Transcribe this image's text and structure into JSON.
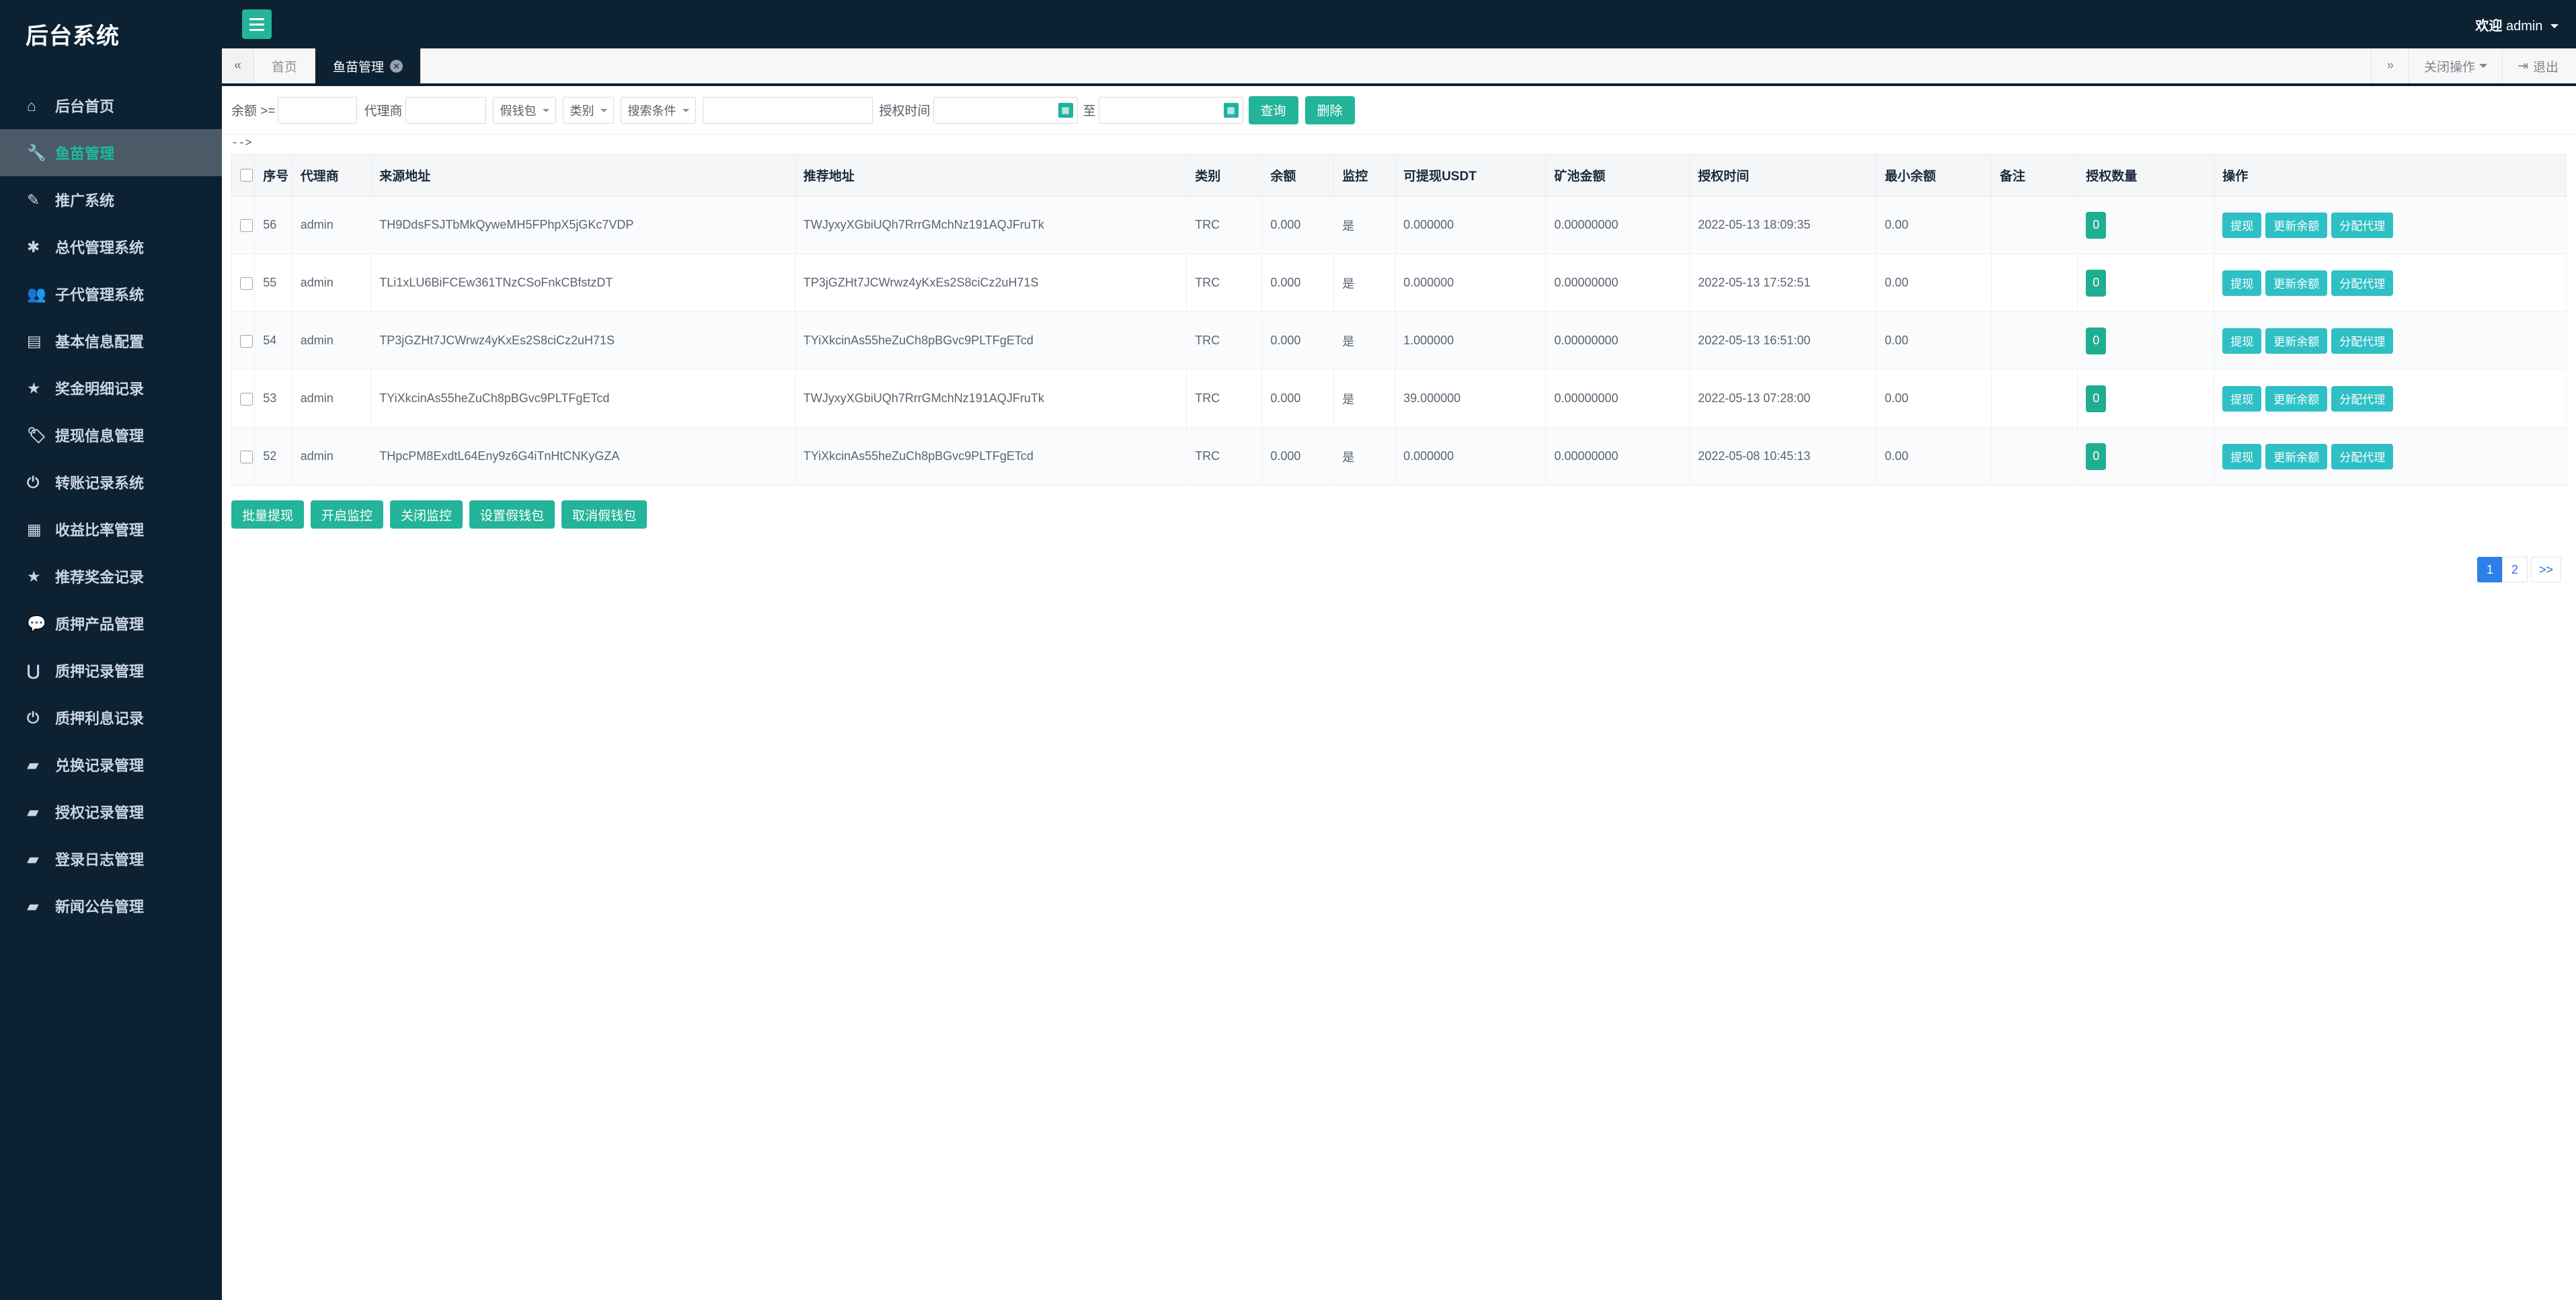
{
  "sidebar": {
    "brand": "后台系统",
    "items": [
      {
        "label": "后台首页",
        "icon": "home-icon",
        "glyph": "⌂",
        "active": false
      },
      {
        "label": "鱼苗管理",
        "icon": "wrench-icon",
        "glyph": "🔧",
        "active": true
      },
      {
        "label": "推广系统",
        "icon": "edit-square-icon",
        "glyph": "✎",
        "active": false
      },
      {
        "label": "总代管理系统",
        "icon": "asterisk-icon",
        "glyph": "✱",
        "active": false
      },
      {
        "label": "子代管理系统",
        "icon": "users-icon",
        "glyph": "👥",
        "active": false
      },
      {
        "label": "基本信息配置",
        "icon": "document-icon",
        "glyph": "▤",
        "active": false
      },
      {
        "label": "奖金明细记录",
        "icon": "star-icon",
        "glyph": "★",
        "active": false
      },
      {
        "label": "提现信息管理",
        "icon": "tag-icon",
        "glyph": "🏷",
        "active": false
      },
      {
        "label": "转账记录系统",
        "icon": "power-icon",
        "glyph": "⏻",
        "active": false
      },
      {
        "label": "收益比率管理",
        "icon": "calendar-icon",
        "glyph": "▦",
        "active": false
      },
      {
        "label": "推荐奖金记录",
        "icon": "star-icon",
        "glyph": "★",
        "active": false
      },
      {
        "label": "质押产品管理",
        "icon": "comment-icon",
        "glyph": "💬",
        "active": false
      },
      {
        "label": "质押记录管理",
        "icon": "magnet-icon",
        "glyph": "⋃",
        "active": false
      },
      {
        "label": "质押利息记录",
        "icon": "power-icon",
        "glyph": "⏻",
        "active": false
      },
      {
        "label": "兑换记录管理",
        "icon": "book-icon",
        "glyph": "▰",
        "active": false
      },
      {
        "label": "授权记录管理",
        "icon": "book-icon",
        "glyph": "▰",
        "active": false
      },
      {
        "label": "登录日志管理",
        "icon": "book-icon",
        "glyph": "▰",
        "active": false
      },
      {
        "label": "新闻公告管理",
        "icon": "book-icon",
        "glyph": "▰",
        "active": false
      }
    ]
  },
  "topbar": {
    "menu_toggle_icon": "hamburger-icon",
    "welcome_prefix": "欢迎",
    "username": "admin"
  },
  "tabstrip": {
    "prev_arrow": "«",
    "next_arrow": "»",
    "tabs": [
      {
        "label": "首页",
        "active": false,
        "closable": false
      },
      {
        "label": "鱼苗管理",
        "active": true,
        "closable": true
      }
    ],
    "close_ops_label": "关闭操作",
    "logout_label": "退出",
    "logout_icon": "logout-icon"
  },
  "toolbar": {
    "balance_label": "余额 >=",
    "balance_value": "",
    "balance_placeholder": "",
    "agent_label": "代理商",
    "agent_value": "",
    "fake_wallet_select": "假钱包",
    "category_select": "类别",
    "search_condition_select": "搜索条件",
    "keyword_value": "",
    "auth_time_label": "授权时间",
    "date_start": "",
    "date_end": "",
    "date_between_label": "至",
    "calendar_icon": "calendar-icon",
    "query_button": "查询",
    "delete_button": "删除"
  },
  "artifact_text": "-->",
  "table": {
    "select_all_icon": "checkbox-icon",
    "headers": [
      "",
      "序号",
      "代理商",
      "来源地址",
      "推荐地址",
      "类别",
      "余额",
      "监控",
      "可提现USDT",
      "矿池金额",
      "授权时间",
      "最小余额",
      "备注",
      "授权数量",
      "操作"
    ],
    "row_actions": [
      "提现",
      "更新余额",
      "分配代理"
    ],
    "rows": [
      {
        "id": "56",
        "agent": "admin",
        "source_address": "TH9DdsFSJTbMkQyweMH5FPhpX5jGKc7VDP",
        "referrer_address": "TWJyxyXGbiUQh7RrrGMchNz191AQJFruTk",
        "category": "TRC",
        "balance": "0.000",
        "monitor": "是",
        "withdrawable_usdt": "0.000000",
        "pool_amount": "0.00000000",
        "auth_time": "2022-05-13 18:09:35",
        "min_balance": "0.00",
        "remark": "",
        "auth_count": "0"
      },
      {
        "id": "55",
        "agent": "admin",
        "source_address": "TLi1xLU6BiFCEw361TNzCSoFnkCBfstzDT",
        "referrer_address": "TP3jGZHt7JCWrwz4yKxEs2S8ciCz2uH71S",
        "category": "TRC",
        "balance": "0.000",
        "monitor": "是",
        "withdrawable_usdt": "0.000000",
        "pool_amount": "0.00000000",
        "auth_time": "2022-05-13 17:52:51",
        "min_balance": "0.00",
        "remark": "",
        "auth_count": "0"
      },
      {
        "id": "54",
        "agent": "admin",
        "source_address": "TP3jGZHt7JCWrwz4yKxEs2S8ciCz2uH71S",
        "referrer_address": "TYiXkcinAs55heZuCh8pBGvc9PLTFgETcd",
        "category": "TRC",
        "balance": "0.000",
        "monitor": "是",
        "withdrawable_usdt": "1.000000",
        "pool_amount": "0.00000000",
        "auth_time": "2022-05-13 16:51:00",
        "min_balance": "0.00",
        "remark": "",
        "auth_count": "0"
      },
      {
        "id": "53",
        "agent": "admin",
        "source_address": "TYiXkcinAs55heZuCh8pBGvc9PLTFgETcd",
        "referrer_address": "TWJyxyXGbiUQh7RrrGMchNz191AQJFruTk",
        "category": "TRC",
        "balance": "0.000",
        "monitor": "是",
        "withdrawable_usdt": "39.000000",
        "pool_amount": "0.00000000",
        "auth_time": "2022-05-13 07:28:00",
        "min_balance": "0.00",
        "remark": "",
        "auth_count": "0"
      },
      {
        "id": "52",
        "agent": "admin",
        "source_address": "THpcPM8ExdtL64Eny9z6G4iTnHtCNKyGZA",
        "referrer_address": "TYiXkcinAs55heZuCh8pBGvc9PLTFgETcd",
        "category": "TRC",
        "balance": "0.000",
        "monitor": "是",
        "withdrawable_usdt": "0.000000",
        "pool_amount": "0.00000000",
        "auth_time": "2022-05-08 10:45:13",
        "min_balance": "0.00",
        "remark": "",
        "auth_count": "0"
      }
    ]
  },
  "bulk_actions": [
    "批量提现",
    "开启监控",
    "关闭监控",
    "设置假钱包",
    "取消假钱包"
  ],
  "pagination": {
    "pages": [
      "1",
      "2"
    ],
    "active_page": "1",
    "next_label": ">>"
  },
  "colors": {
    "sidebar_bg": "#0c2233",
    "accent_green": "#23b499",
    "accent_teal": "#2fc0c5",
    "active_nav_text": "#1abc9c",
    "pager_blue": "#2f7fe8"
  }
}
